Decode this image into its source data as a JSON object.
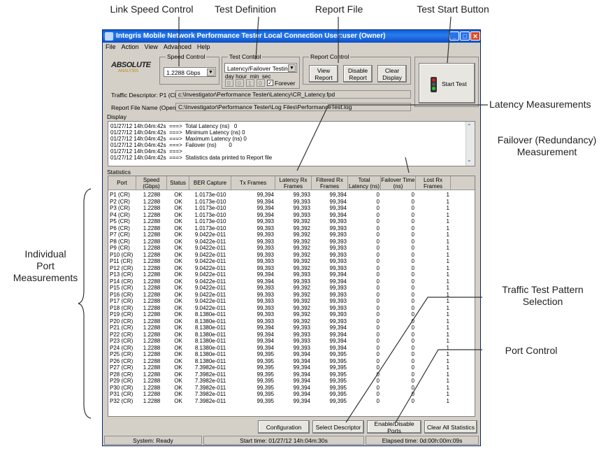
{
  "callouts": {
    "link_speed": "Link Speed Control",
    "test_definition": "Test Definition",
    "report_file": "Report File",
    "test_start": "Test Start Button",
    "latency": "Latency Measurements",
    "failover_1": "Failover (Redundancy)",
    "failover_2": "Measurement",
    "individual_1": "Individual",
    "individual_2": "Port",
    "individual_3": "Measurements",
    "traffic_1": "Traffic Test Pattern",
    "traffic_2": "Selection",
    "port_control": "Port Control"
  },
  "window": {
    "title": "Integris Mobile Network Performance Tester  Local Connection  User:user (Owner)"
  },
  "menu": [
    "File",
    "Action",
    "View",
    "Advanced",
    "Help"
  ],
  "logo": {
    "name": "ABSOLUTE",
    "sub": "ANALYSIS"
  },
  "speed_control": {
    "label": "Speed Control",
    "value": "1.2288 Gbps"
  },
  "test_control": {
    "label": "Test Control",
    "value": "Latency/Failover Testing",
    "time_labels": "day hour  min  sec",
    "time_values": [
      "0",
      "0",
      "1",
      "0"
    ],
    "forever_label": "Forever"
  },
  "report_control": {
    "label": "Report Control",
    "view": "View Report",
    "disable": "Disable Report",
    "clear": "Clear Display"
  },
  "start_test": "Start Test",
  "traffic_descriptor": {
    "label": "Traffic Descriptor: P1 (CR)",
    "value": "c:\\Investigator\\Performance Tester\\Latency\\CR_Latency.fpd"
  },
  "report_file": {
    "label": "Report File Name (Open)",
    "value": "C:\\Investigator\\Performance Tester\\Log Files\\PerformanceTest.log"
  },
  "display": {
    "label": "Display",
    "lines": [
      "01/27/12 14h:04m:42s  ===>  Total Latency (ns)   0",
      "01/27/12 14h:04m:42s  ===>  Minimum Latency (ns) 0",
      "01/27/12 14h:04m:42s  ===>  Maximum Latency (ns) 0",
      "01/27/12 14h:04m:42s  ===>  Failover (ns)        0",
      "01/27/12 14h:04m:42s  ===>",
      "01/27/12 14h:04m:42s  ===>  Statistics data printed to Report file"
    ]
  },
  "statistics": {
    "label": "Statistics",
    "columns": [
      "Port",
      "Speed (Gbps)",
      "Status",
      "BER Capture",
      "Tx Frames",
      "Latency Rx Frames",
      "Filtered Rx Frames",
      "Total Latency (ns)",
      "Failover Time (ns)",
      "Lost Rx Frames"
    ],
    "rows": [
      [
        "P1 (CR)",
        "1.2288",
        "OK",
        "1.0173e-010",
        "99,394",
        "99,393",
        "99,394",
        "0",
        "0",
        "1"
      ],
      [
        "P2 (CR)",
        "1.2288",
        "OK",
        "1.0173e-010",
        "99,394",
        "99,393",
        "99,394",
        "0",
        "0",
        "1"
      ],
      [
        "P3 (CR)",
        "1.2288",
        "OK",
        "1.0173e-010",
        "99,394",
        "99,393",
        "99,394",
        "0",
        "0",
        "1"
      ],
      [
        "P4 (CR)",
        "1.2288",
        "OK",
        "1.0173e-010",
        "99,394",
        "99,393",
        "99,394",
        "0",
        "0",
        "1"
      ],
      [
        "P5 (CR)",
        "1.2288",
        "OK",
        "1.0173e-010",
        "99,393",
        "99,392",
        "99,393",
        "0",
        "0",
        "1"
      ],
      [
        "P6 (CR)",
        "1.2288",
        "OK",
        "1.0173e-010",
        "99,393",
        "99,392",
        "99,393",
        "0",
        "0",
        "1"
      ],
      [
        "P7 (CR)",
        "1.2288",
        "OK",
        "9.0422e-011",
        "99,393",
        "99,392",
        "99,393",
        "0",
        "0",
        "1"
      ],
      [
        "P8 (CR)",
        "1.2288",
        "OK",
        "9.0422e-011",
        "99,393",
        "99,392",
        "99,393",
        "0",
        "0",
        "1"
      ],
      [
        "P9 (CR)",
        "1.2288",
        "OK",
        "9.0422e-011",
        "99,393",
        "99,392",
        "99,393",
        "0",
        "0",
        "1"
      ],
      [
        "P10 (CR)",
        "1.2288",
        "OK",
        "9.0422e-011",
        "99,393",
        "99,392",
        "99,393",
        "0",
        "0",
        "1"
      ],
      [
        "P11 (CR)",
        "1.2288",
        "OK",
        "9.0422e-011",
        "99,393",
        "99,392",
        "99,393",
        "0",
        "0",
        "1"
      ],
      [
        "P12 (CR)",
        "1.2288",
        "OK",
        "9.0422e-011",
        "99,393",
        "99,392",
        "99,393",
        "0",
        "0",
        "1"
      ],
      [
        "P13 (CR)",
        "1.2288",
        "OK",
        "9.0422e-011",
        "99,394",
        "99,393",
        "99,394",
        "0",
        "0",
        "1"
      ],
      [
        "P14 (CR)",
        "1.2288",
        "OK",
        "9.0422e-011",
        "99,394",
        "99,393",
        "99,394",
        "0",
        "0",
        "1"
      ],
      [
        "P15 (CR)",
        "1.2288",
        "OK",
        "9.0422e-011",
        "99,393",
        "99,392",
        "99,393",
        "0",
        "0",
        "1"
      ],
      [
        "P16 (CR)",
        "1.2288",
        "OK",
        "9.0422e-011",
        "99,393",
        "99,392",
        "99,393",
        "0",
        "0",
        "1"
      ],
      [
        "P17 (CR)",
        "1.2288",
        "OK",
        "9.0422e-011",
        "99,393",
        "99,392",
        "99,393",
        "0",
        "0",
        "1"
      ],
      [
        "P18 (CR)",
        "1.2288",
        "OK",
        "9.0422e-011",
        "99,393",
        "99,392",
        "99,393",
        "0",
        "0",
        "1"
      ],
      [
        "P19 (CR)",
        "1.2288",
        "OK",
        "8.1380e-011",
        "99,393",
        "99,392",
        "99,393",
        "0",
        "0",
        "1"
      ],
      [
        "P20 (CR)",
        "1.2288",
        "OK",
        "8.1380e-011",
        "99,393",
        "99,392",
        "99,393",
        "0",
        "0",
        "1"
      ],
      [
        "P21 (CR)",
        "1.2288",
        "OK",
        "8.1380e-011",
        "99,394",
        "99,393",
        "99,394",
        "0",
        "0",
        "1"
      ],
      [
        "P22 (CR)",
        "1.2288",
        "OK",
        "8.1380e-011",
        "99,394",
        "99,393",
        "99,394",
        "0",
        "0",
        "1"
      ],
      [
        "P23 (CR)",
        "1.2288",
        "OK",
        "8.1380e-011",
        "99,394",
        "99,393",
        "99,394",
        "0",
        "0",
        "1"
      ],
      [
        "P24 (CR)",
        "1.2288",
        "OK",
        "8.1380e-011",
        "99,394",
        "99,393",
        "99,394",
        "0",
        "0",
        "1"
      ],
      [
        "P25 (CR)",
        "1.2288",
        "OK",
        "8.1380e-011",
        "99,395",
        "99,394",
        "99,395",
        "0",
        "0",
        "1"
      ],
      [
        "P26 (CR)",
        "1.2288",
        "OK",
        "8.1380e-011",
        "99,395",
        "99,394",
        "99,395",
        "0",
        "0",
        "1"
      ],
      [
        "P27 (CR)",
        "1.2288",
        "OK",
        "7.3982e-011",
        "99,395",
        "99,394",
        "99,395",
        "0",
        "0",
        "1"
      ],
      [
        "P28 (CR)",
        "1.2288",
        "OK",
        "7.3982e-011",
        "99,395",
        "99,394",
        "99,395",
        "0",
        "0",
        "1"
      ],
      [
        "P29 (CR)",
        "1.2288",
        "OK",
        "7.3982e-011",
        "99,395",
        "99,394",
        "99,395",
        "0",
        "0",
        "1"
      ],
      [
        "P30 (CR)",
        "1.2288",
        "OK",
        "7.3982e-011",
        "99,395",
        "99,394",
        "99,395",
        "0",
        "0",
        "1"
      ],
      [
        "P31 (CR)",
        "1.2288",
        "OK",
        "7.3982e-011",
        "99,395",
        "99,394",
        "99,395",
        "0",
        "0",
        "1"
      ],
      [
        "P32 (CR)",
        "1.2288",
        "OK",
        "7.3982e-011",
        "99,395",
        "99,394",
        "99,395",
        "0",
        "0",
        "1"
      ]
    ]
  },
  "bottom_buttons": {
    "configuration": "Configuration",
    "select_descriptor": "Select Descriptor",
    "enable_disable_ports": "Enable/Disable Ports",
    "clear_all_statistics": "Clear All Statistics"
  },
  "status_bar": {
    "system": "System: Ready",
    "start_time": "Start time: 01/27/12  14h:04m:30s",
    "elapsed": "Elapsed time: 0d:00h:00m:09s"
  },
  "colors": {
    "titlebar": "#0a5fd8",
    "window_bg": "#d4d0c8",
    "traffic_light_red": "#cc2222",
    "traffic_light_green": "#22cc33"
  }
}
